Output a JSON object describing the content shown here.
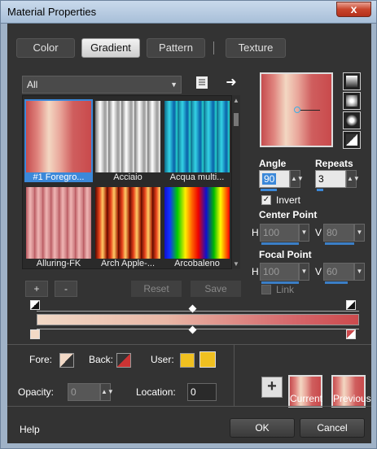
{
  "window": {
    "title": "Material Properties",
    "close_glyph": "x"
  },
  "tabs": [
    {
      "label": "Color",
      "active": false
    },
    {
      "label": "Gradient",
      "active": true
    },
    {
      "label": "Pattern",
      "active": false
    },
    {
      "label": "Texture",
      "active": false
    }
  ],
  "category": {
    "selected": "All"
  },
  "gradients": [
    {
      "name": "#1 Foregro...",
      "selected": true,
      "swatch": "pink-cream"
    },
    {
      "name": "Acciaio",
      "selected": false,
      "swatch": "steel"
    },
    {
      "name": "Acqua multi...",
      "selected": false,
      "swatch": "aqua"
    },
    {
      "name": "Alluring-FK",
      "selected": false,
      "swatch": "rose-stripes"
    },
    {
      "name": "Arch Apple-...",
      "selected": false,
      "swatch": "red-stripes"
    },
    {
      "name": "Arcobaleno",
      "selected": false,
      "swatch": "rainbow"
    }
  ],
  "list_buttons": {
    "add": "+",
    "remove": "-",
    "reset": "Reset",
    "save": "Save"
  },
  "props": {
    "angle_label": "Angle",
    "angle": "90",
    "repeats_label": "Repeats",
    "repeats": "3",
    "invert_label": "Invert",
    "invert_checked": true,
    "center_point_label": "Center Point",
    "center_h_label": "H",
    "center_h": "100",
    "center_v_label": "V",
    "center_v": "80",
    "focal_point_label": "Focal Point",
    "focal_h_label": "H",
    "focal_h": "100",
    "focal_v_label": "V",
    "focal_v": "60",
    "link_label": "Link",
    "link_checked": false
  },
  "colors": {
    "fore_label": "Fore:",
    "back_label": "Back:",
    "user_label": "User:",
    "user_color": "#f0c020",
    "back_color": "#cc3333",
    "gradient_start": "#f2d9c6",
    "gradient_end": "#cc4a4d"
  },
  "stops": {
    "opacity_label": "Opacity:",
    "opacity": "0",
    "location_label": "Location:",
    "location": "0"
  },
  "swatches": {
    "current_label": "Current",
    "previous_label": "Previous",
    "add_glyph": "+"
  },
  "footer": {
    "help": "Help",
    "ok": "OK",
    "cancel": "Cancel"
  }
}
